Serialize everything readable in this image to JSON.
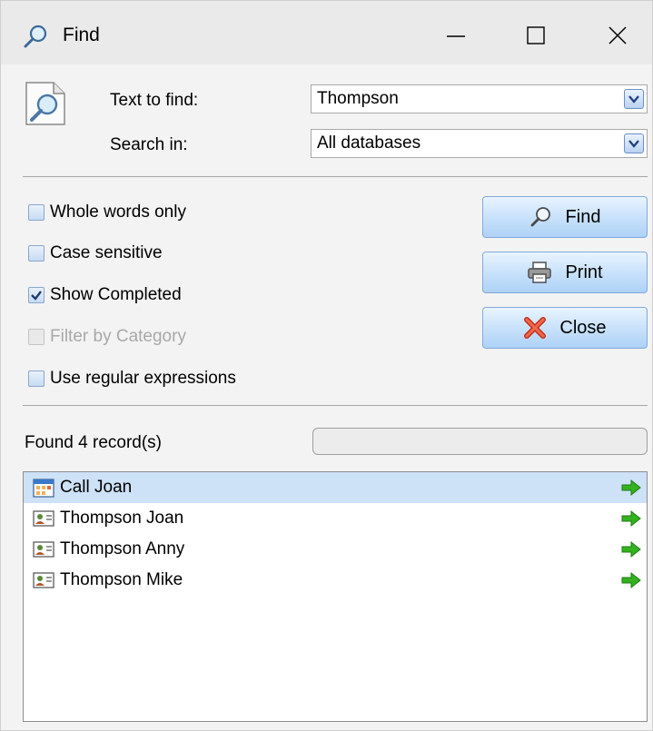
{
  "window": {
    "title": "Find",
    "controls": {
      "minimize": "—",
      "maximize": "☐",
      "close": "✕"
    }
  },
  "search": {
    "text_label": "Text to find:",
    "text_value": "Thompson",
    "search_in_label": "Search in:",
    "search_in_value": "All databases"
  },
  "options": [
    {
      "label": "Whole words only",
      "checked": false,
      "enabled": true
    },
    {
      "label": "Case sensitive",
      "checked": false,
      "enabled": true
    },
    {
      "label": "Show Completed",
      "checked": true,
      "enabled": true
    },
    {
      "label": "Filter by Category",
      "checked": false,
      "enabled": false
    },
    {
      "label": "Use regular expressions",
      "checked": false,
      "enabled": true
    }
  ],
  "buttons": {
    "find": "Find",
    "print": "Print",
    "close": "Close"
  },
  "results": {
    "status": "Found 4 record(s)",
    "progress": 0,
    "items": [
      {
        "label": "Call Joan",
        "icon": "calendar-icon",
        "selected": true
      },
      {
        "label": "Thompson Joan",
        "icon": "contact-card-icon",
        "selected": false
      },
      {
        "label": "Thompson Anny",
        "icon": "contact-card-icon",
        "selected": false
      },
      {
        "label": "Thompson Mike",
        "icon": "contact-card-icon",
        "selected": false
      }
    ]
  },
  "colors": {
    "accent": "#cde1f7",
    "button_top": "#e9f4ff",
    "button_bottom": "#aed2f6",
    "go_arrow": "#2db01f",
    "close_x": "#e8422b"
  }
}
